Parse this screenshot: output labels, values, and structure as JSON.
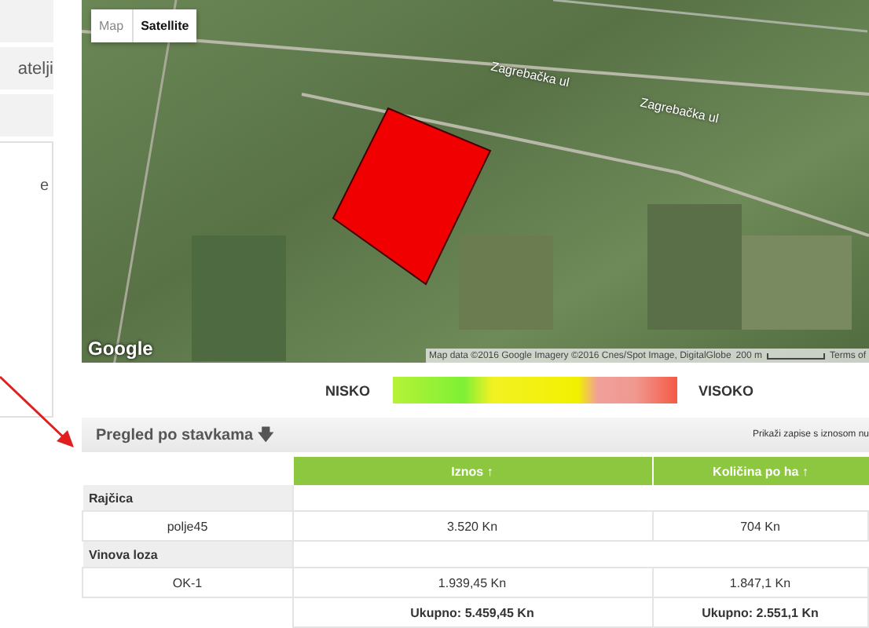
{
  "sidebar": {
    "items": [
      {
        "kind": "blank"
      },
      {
        "kind": "text",
        "label": "atelji"
      },
      {
        "kind": "blank"
      }
    ],
    "panel_texts": [
      "e"
    ]
  },
  "map": {
    "type_buttons": [
      {
        "label": "Map",
        "selected": false
      },
      {
        "label": "Satellite",
        "selected": true
      }
    ],
    "street_labels": [
      "Zagrebačka ul",
      "Zagrebačka ul"
    ],
    "logo": "Google",
    "attribution": "Map data ©2016 Google Imagery ©2016 Cnes/Spot Image, DigitalGlobe",
    "scale": "200 m",
    "terms": "Terms of"
  },
  "legend": {
    "low": "NISKO",
    "high": "VISOKO"
  },
  "section": {
    "title": "Pregled po stavkama",
    "sort_icon": "🡇",
    "filter_text": "Prikaži zapise s iznosom nu"
  },
  "table": {
    "columns": [
      "",
      "Iznos ↑",
      "Količina po ha ↑"
    ],
    "rows": [
      {
        "kind": "group",
        "cells": [
          "Rajčica"
        ]
      },
      {
        "kind": "item",
        "cells": [
          "polje45",
          "3.520 Kn",
          "704 Kn"
        ]
      },
      {
        "kind": "group",
        "cells": [
          "Vinova loza"
        ]
      },
      {
        "kind": "item",
        "cells": [
          "OK-1",
          "1.939,45 Kn",
          "1.847,1 Kn"
        ]
      },
      {
        "kind": "total",
        "cells": [
          "",
          "Ukupno: 5.459,45 Kn",
          "Ukupno: 2.551,1 Kn"
        ]
      }
    ]
  }
}
